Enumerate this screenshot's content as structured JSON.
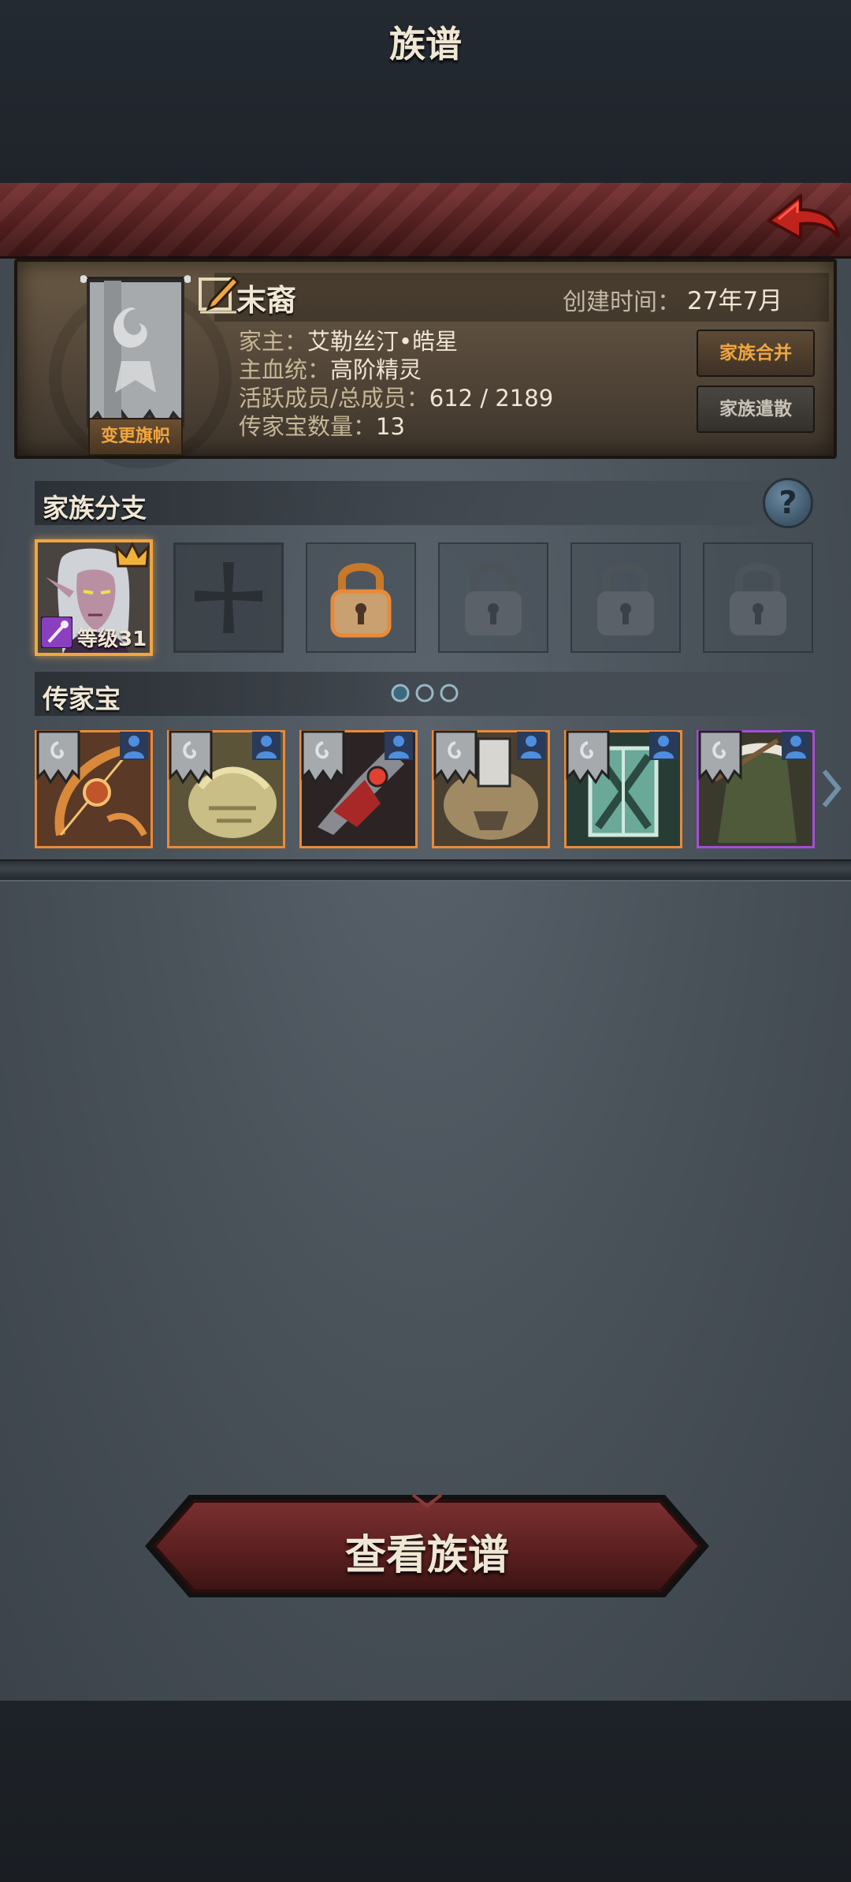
{
  "title": "族谱",
  "family": {
    "name": "末裔",
    "change_banner_label": "变更旗帜",
    "created_label": "创建时间：",
    "created_value": "27年7月",
    "patriarch_label": "家主：",
    "patriarch_value": "艾勒丝汀•皓星",
    "bloodline_label": "主血统：",
    "bloodline_value": "高阶精灵",
    "members_label": "活跃成员/总成员：",
    "members_value": "612 / 2189",
    "heirloom_count_label": "传家宝数量：",
    "heirloom_count_value": "13",
    "merge_button": "家族合并",
    "dissolve_button": "家族遣散"
  },
  "branches": {
    "title": "家族分支",
    "hero_level": "等级31"
  },
  "heirlooms": {
    "title": "传家宝",
    "page_indicator_count": 3,
    "items": [
      {
        "name": "heirloom-bow",
        "rarity": "orange"
      },
      {
        "name": "heirloom-armor",
        "rarity": "orange"
      },
      {
        "name": "heirloom-axe",
        "rarity": "orange"
      },
      {
        "name": "heirloom-beast-helm",
        "rarity": "orange"
      },
      {
        "name": "heirloom-shield",
        "rarity": "orange"
      },
      {
        "name": "heirloom-cloak",
        "rarity": "purple"
      }
    ]
  },
  "view_button": "查看族谱",
  "colors": {
    "accent_gold": "#f0a640",
    "title_red": "#5a2222",
    "rarity_orange": "#e98a3a",
    "rarity_purple": "#a24ed8"
  }
}
